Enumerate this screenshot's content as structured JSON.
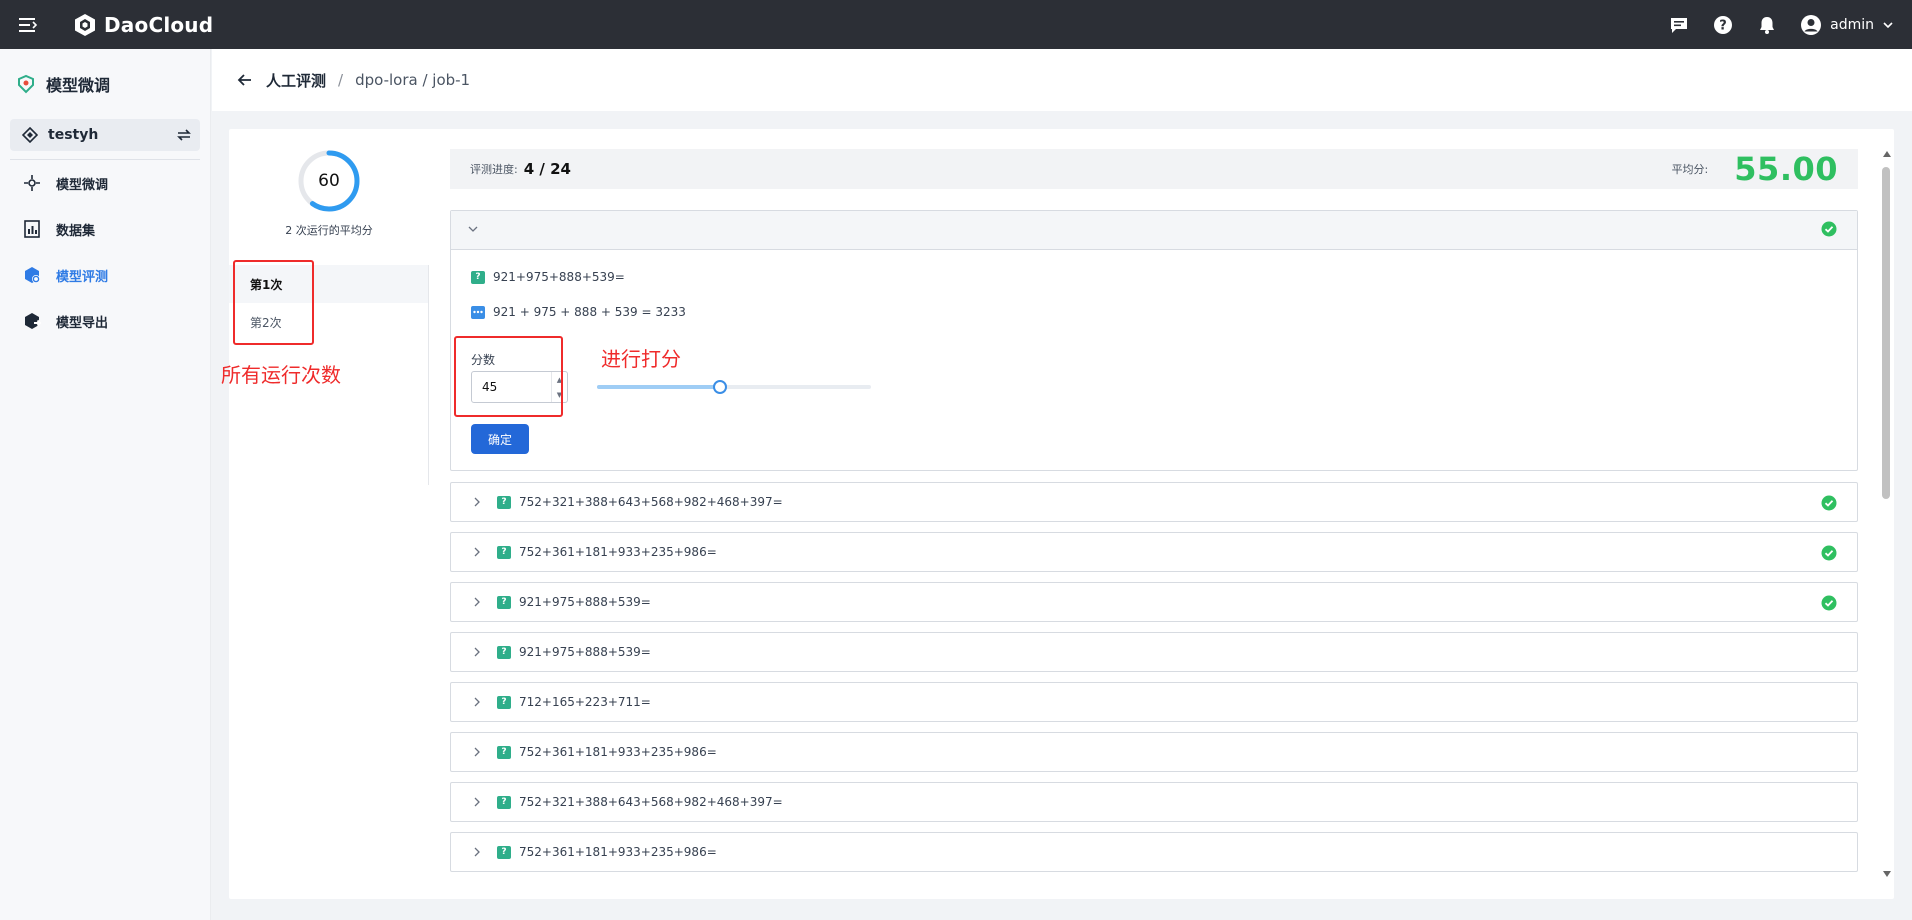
{
  "app": {
    "name": "DaoCloud"
  },
  "header": {
    "user": "admin"
  },
  "sidebar": {
    "title": "模型微调",
    "workspace": "testyh",
    "items": [
      {
        "label": "模型微调",
        "icon": "finetune-icon",
        "active": false
      },
      {
        "label": "数据集",
        "icon": "dataset-icon",
        "active": false
      },
      {
        "label": "模型评测",
        "icon": "evaluate-icon",
        "active": true
      },
      {
        "label": "模型导出",
        "icon": "export-icon",
        "active": false
      }
    ]
  },
  "breadcrumb": {
    "root": "人工评测",
    "separator": "/",
    "path": "dpo-lora / job-1"
  },
  "summary": {
    "gauge_value": "60",
    "gauge_fraction": 0.6,
    "caption": "2 次运行的平均分"
  },
  "runs": [
    {
      "label": "第1次",
      "active": true
    },
    {
      "label": "第2次",
      "active": false
    }
  ],
  "annotations": {
    "runs": "所有运行次数",
    "score": "进行打分"
  },
  "progress": {
    "label": "评测进度:",
    "value": "4 / 24",
    "avg_label": "平均分:",
    "avg_value": "55.00"
  },
  "current": {
    "question": "921+975+888+539=",
    "answer": "921 + 975 + 888 + 539 = 3233",
    "score_label": "分数",
    "score_value": "45",
    "slider_fraction": 0.45,
    "confirm_label": "确定",
    "done": true
  },
  "items": [
    {
      "question": "752+321+388+643+568+982+468+397=",
      "done": true
    },
    {
      "question": "752+361+181+933+235+986=",
      "done": true
    },
    {
      "question": "921+975+888+539=",
      "done": true
    },
    {
      "question": "921+975+888+539=",
      "done": false
    },
    {
      "question": "712+165+223+711=",
      "done": false
    },
    {
      "question": "752+361+181+933+235+986=",
      "done": false
    },
    {
      "question": "752+321+388+643+568+982+468+397=",
      "done": false
    },
    {
      "question": "752+361+181+933+235+986=",
      "done": false
    }
  ],
  "colors": {
    "accent": "#2f7be5",
    "success": "#2fbf60",
    "annotation": "#ef2b2b",
    "topbar": "#2c2f36"
  }
}
